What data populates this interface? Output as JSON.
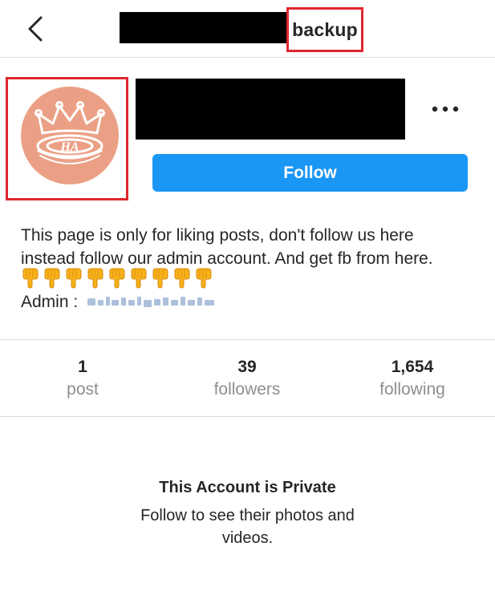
{
  "header": {
    "title": "backup"
  },
  "profile": {
    "follow_label": "Follow",
    "bio_line1": "This page is only for liking posts, don't follow us here",
    "bio_line2": "instead follow our admin account. And get fb from here.",
    "emoji_count": 9,
    "admin_label": "Admin :"
  },
  "stats": {
    "posts": {
      "value": "1",
      "label": "post"
    },
    "followers": {
      "value": "39",
      "label": "followers"
    },
    "following": {
      "value": "1,654",
      "label": "following"
    }
  },
  "private": {
    "title": "This Account is Private",
    "description": "Follow to see their photos and videos."
  },
  "avatar_logo_text": "HA",
  "colors": {
    "accent": "#1a96f4",
    "annotation": "#e0262e",
    "avatar_bg": "#eba085",
    "redaction": "#000000",
    "muted": "#8e8e8e"
  }
}
